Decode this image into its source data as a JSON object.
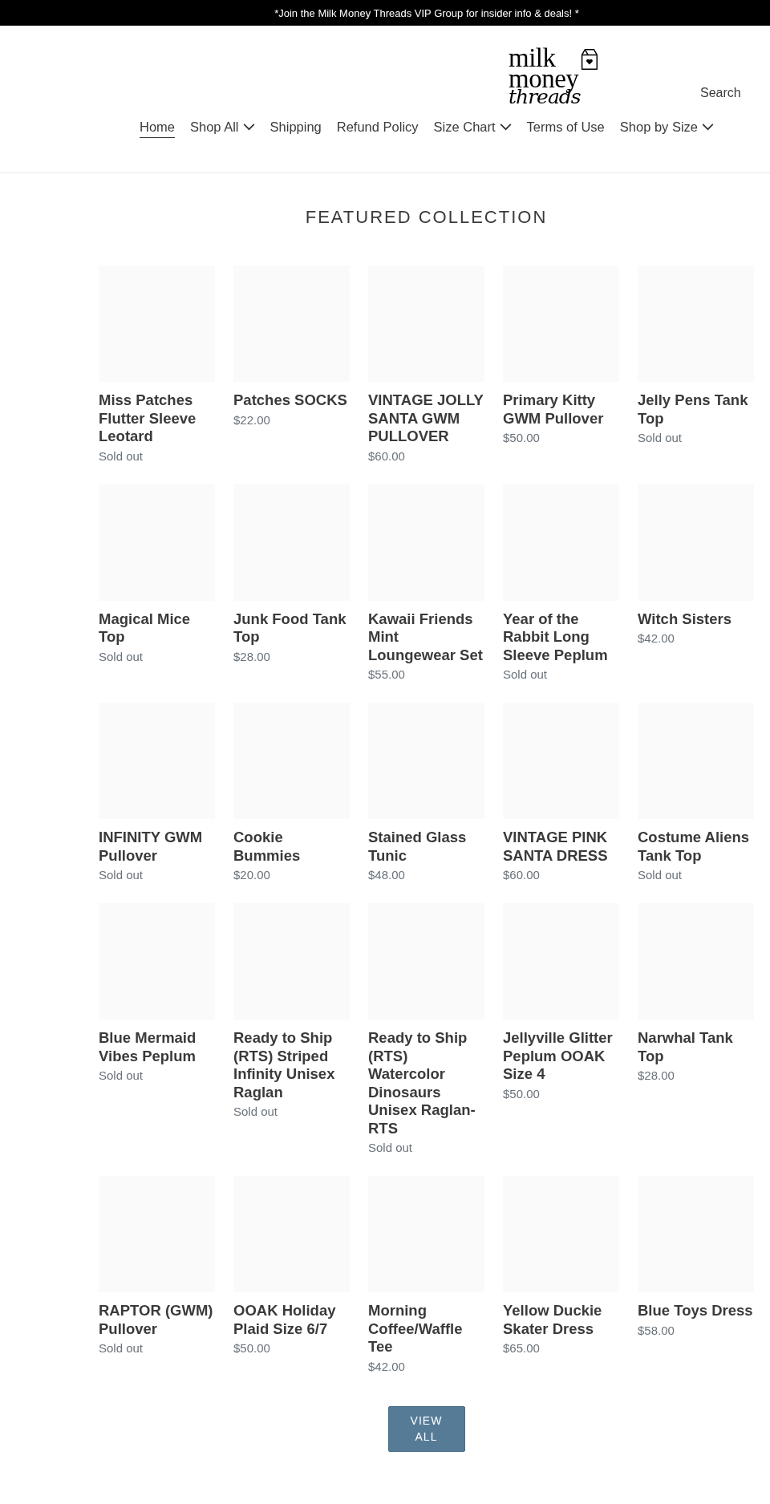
{
  "announcement": "*Join the Milk Money Threads VIP Group for insider info & deals! *",
  "logo": {
    "line_1": "milk",
    "line_2": "money",
    "line_3": "threads"
  },
  "search": {
    "label": "Search"
  },
  "nav": [
    {
      "label": "Home",
      "selected": true,
      "dropdown": false
    },
    {
      "label": "Shop All",
      "selected": false,
      "dropdown": true
    },
    {
      "label": "Shipping",
      "selected": false,
      "dropdown": false
    },
    {
      "label": "Refund Policy",
      "selected": false,
      "dropdown": false
    },
    {
      "label": "Size Chart",
      "selected": false,
      "dropdown": true
    },
    {
      "label": "Terms of Use",
      "selected": false,
      "dropdown": false
    },
    {
      "label": "Shop by Size",
      "selected": false,
      "dropdown": true
    }
  ],
  "section_title": "FEATURED COLLECTION",
  "products": [
    {
      "name": "Miss Patches Flutter Sleeve Leotard",
      "price": "Sold out"
    },
    {
      "name": "Patches SOCKS",
      "price": "$22.00"
    },
    {
      "name": "VINTAGE JOLLY SANTA GWM PULLOVER",
      "price": "$60.00"
    },
    {
      "name": "Primary Kitty GWM Pullover",
      "price": "$50.00"
    },
    {
      "name": "Jelly Pens Tank Top",
      "price": "Sold out"
    },
    {
      "name": "Magical Mice Top",
      "price": "Sold out"
    },
    {
      "name": "Junk Food Tank Top",
      "price": "$28.00"
    },
    {
      "name": "Kawaii Friends Mint Loungewear Set",
      "price": "$55.00"
    },
    {
      "name": "Year of the Rabbit Long Sleeve Peplum",
      "price": "Sold out"
    },
    {
      "name": "Witch Sisters",
      "price": "$42.00"
    },
    {
      "name": "INFINITY GWM Pullover",
      "price": "Sold out"
    },
    {
      "name": "Cookie Bummies",
      "price": "$20.00"
    },
    {
      "name": "Stained Glass Tunic",
      "price": "$48.00"
    },
    {
      "name": "VINTAGE PINK SANTA DRESS",
      "price": "$60.00"
    },
    {
      "name": "Costume Aliens Tank Top",
      "price": "Sold out"
    },
    {
      "name": "Blue Mermaid Vibes Peplum",
      "price": "Sold out"
    },
    {
      "name": "Ready to Ship (RTS) Striped Infinity Unisex Raglan",
      "price": "Sold out"
    },
    {
      "name": "Ready to Ship (RTS) Watercolor Dinosaurs Unisex Raglan-RTS",
      "price": "Sold out"
    },
    {
      "name": "Jellyville Glitter Peplum OOAK Size 4",
      "price": "$50.00"
    },
    {
      "name": "Narwhal Tank Top",
      "price": "$28.00"
    },
    {
      "name": "RAPTOR (GWM) Pullover",
      "price": "Sold out"
    },
    {
      "name": "OOAK Holiday Plaid Size 6/7",
      "price": "$50.00"
    },
    {
      "name": "Morning Coffee/Waffle Tee",
      "price": "$42.00"
    },
    {
      "name": "Yellow Duckie Skater Dress",
      "price": "$65.00"
    },
    {
      "name": "Blue Toys Dress",
      "price": "$58.00"
    }
  ],
  "view_all": "VIEW ALL"
}
